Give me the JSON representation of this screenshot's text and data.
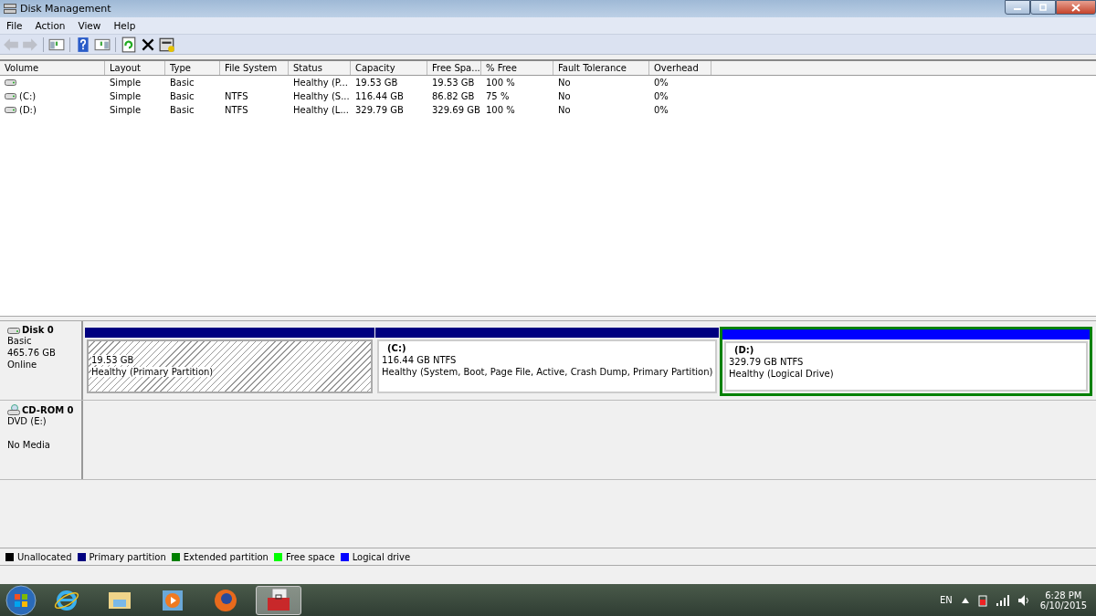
{
  "window": {
    "title": "Disk Management"
  },
  "menu": [
    "File",
    "Action",
    "View",
    "Help"
  ],
  "toolbar": [
    {
      "kind": "back",
      "disabled": true
    },
    {
      "kind": "forward",
      "disabled": true
    },
    {
      "kind": "sep"
    },
    {
      "kind": "tree",
      "disabled": false
    },
    {
      "kind": "sep"
    },
    {
      "kind": "help",
      "disabled": false
    },
    {
      "kind": "pane",
      "disabled": false
    },
    {
      "kind": "sep"
    },
    {
      "kind": "refresh",
      "disabled": false
    },
    {
      "kind": "delete",
      "disabled": false
    },
    {
      "kind": "properties",
      "disabled": false
    }
  ],
  "table": {
    "columns": [
      "Volume",
      "Layout",
      "Type",
      "File System",
      "Status",
      "Capacity",
      "Free Spa...",
      "% Free",
      "Fault Tolerance",
      "Overhead"
    ],
    "rows": [
      [
        "",
        "Simple",
        "Basic",
        "",
        "Healthy (P...",
        "19.53 GB",
        "19.53 GB",
        "100 %",
        "No",
        "0%"
      ],
      [
        "(C:)",
        "Simple",
        "Basic",
        "NTFS",
        "Healthy (S...",
        "116.44 GB",
        "86.82 GB",
        "75 %",
        "No",
        "0%"
      ],
      [
        "(D:)",
        "Simple",
        "Basic",
        "NTFS",
        "Healthy (L...",
        "329.79 GB",
        "329.69 GB",
        "100 %",
        "No",
        "0%"
      ]
    ]
  },
  "disks": [
    {
      "kind": "disk",
      "name": "Disk 0",
      "lines": [
        "Basic",
        "465.76 GB"
      ],
      "state": "Online",
      "partitions": [
        {
          "kind": "primary",
          "selected": true,
          "size": "19.53 GB",
          "status": "Healthy (Primary Partition)"
        },
        {
          "kind": "primary",
          "selected": false,
          "label": "(C:)",
          "size": "116.44 GB NTFS",
          "status": "Healthy (System, Boot, Page File, Active, Crash Dump, Primary Partition)"
        },
        {
          "kind": "logical",
          "selected": false,
          "label": "(D:)",
          "size": "329.79 GB NTFS",
          "status": "Healthy (Logical Drive)"
        }
      ]
    },
    {
      "kind": "cdrom",
      "name": "CD-ROM 0",
      "lines": [
        "DVD (E:)"
      ],
      "state": "No Media"
    }
  ],
  "legend": [
    {
      "label": "Unallocated",
      "color": "#000000"
    },
    {
      "label": "Primary partition",
      "color": "#000080"
    },
    {
      "label": "Extended partition",
      "color": "#008000"
    },
    {
      "label": "Free space",
      "color": "#00ff00"
    },
    {
      "label": "Logical drive",
      "color": "#0000ff"
    }
  ],
  "taskbar": {
    "items": [
      {
        "kind": "ie",
        "selected": false
      },
      {
        "kind": "explorer",
        "selected": false
      },
      {
        "kind": "media",
        "selected": false
      },
      {
        "kind": "firefox",
        "selected": false
      },
      {
        "kind": "toolbox",
        "selected": true
      }
    ],
    "language": "EN",
    "time": "6:28 PM",
    "date": "6/10/2015"
  }
}
